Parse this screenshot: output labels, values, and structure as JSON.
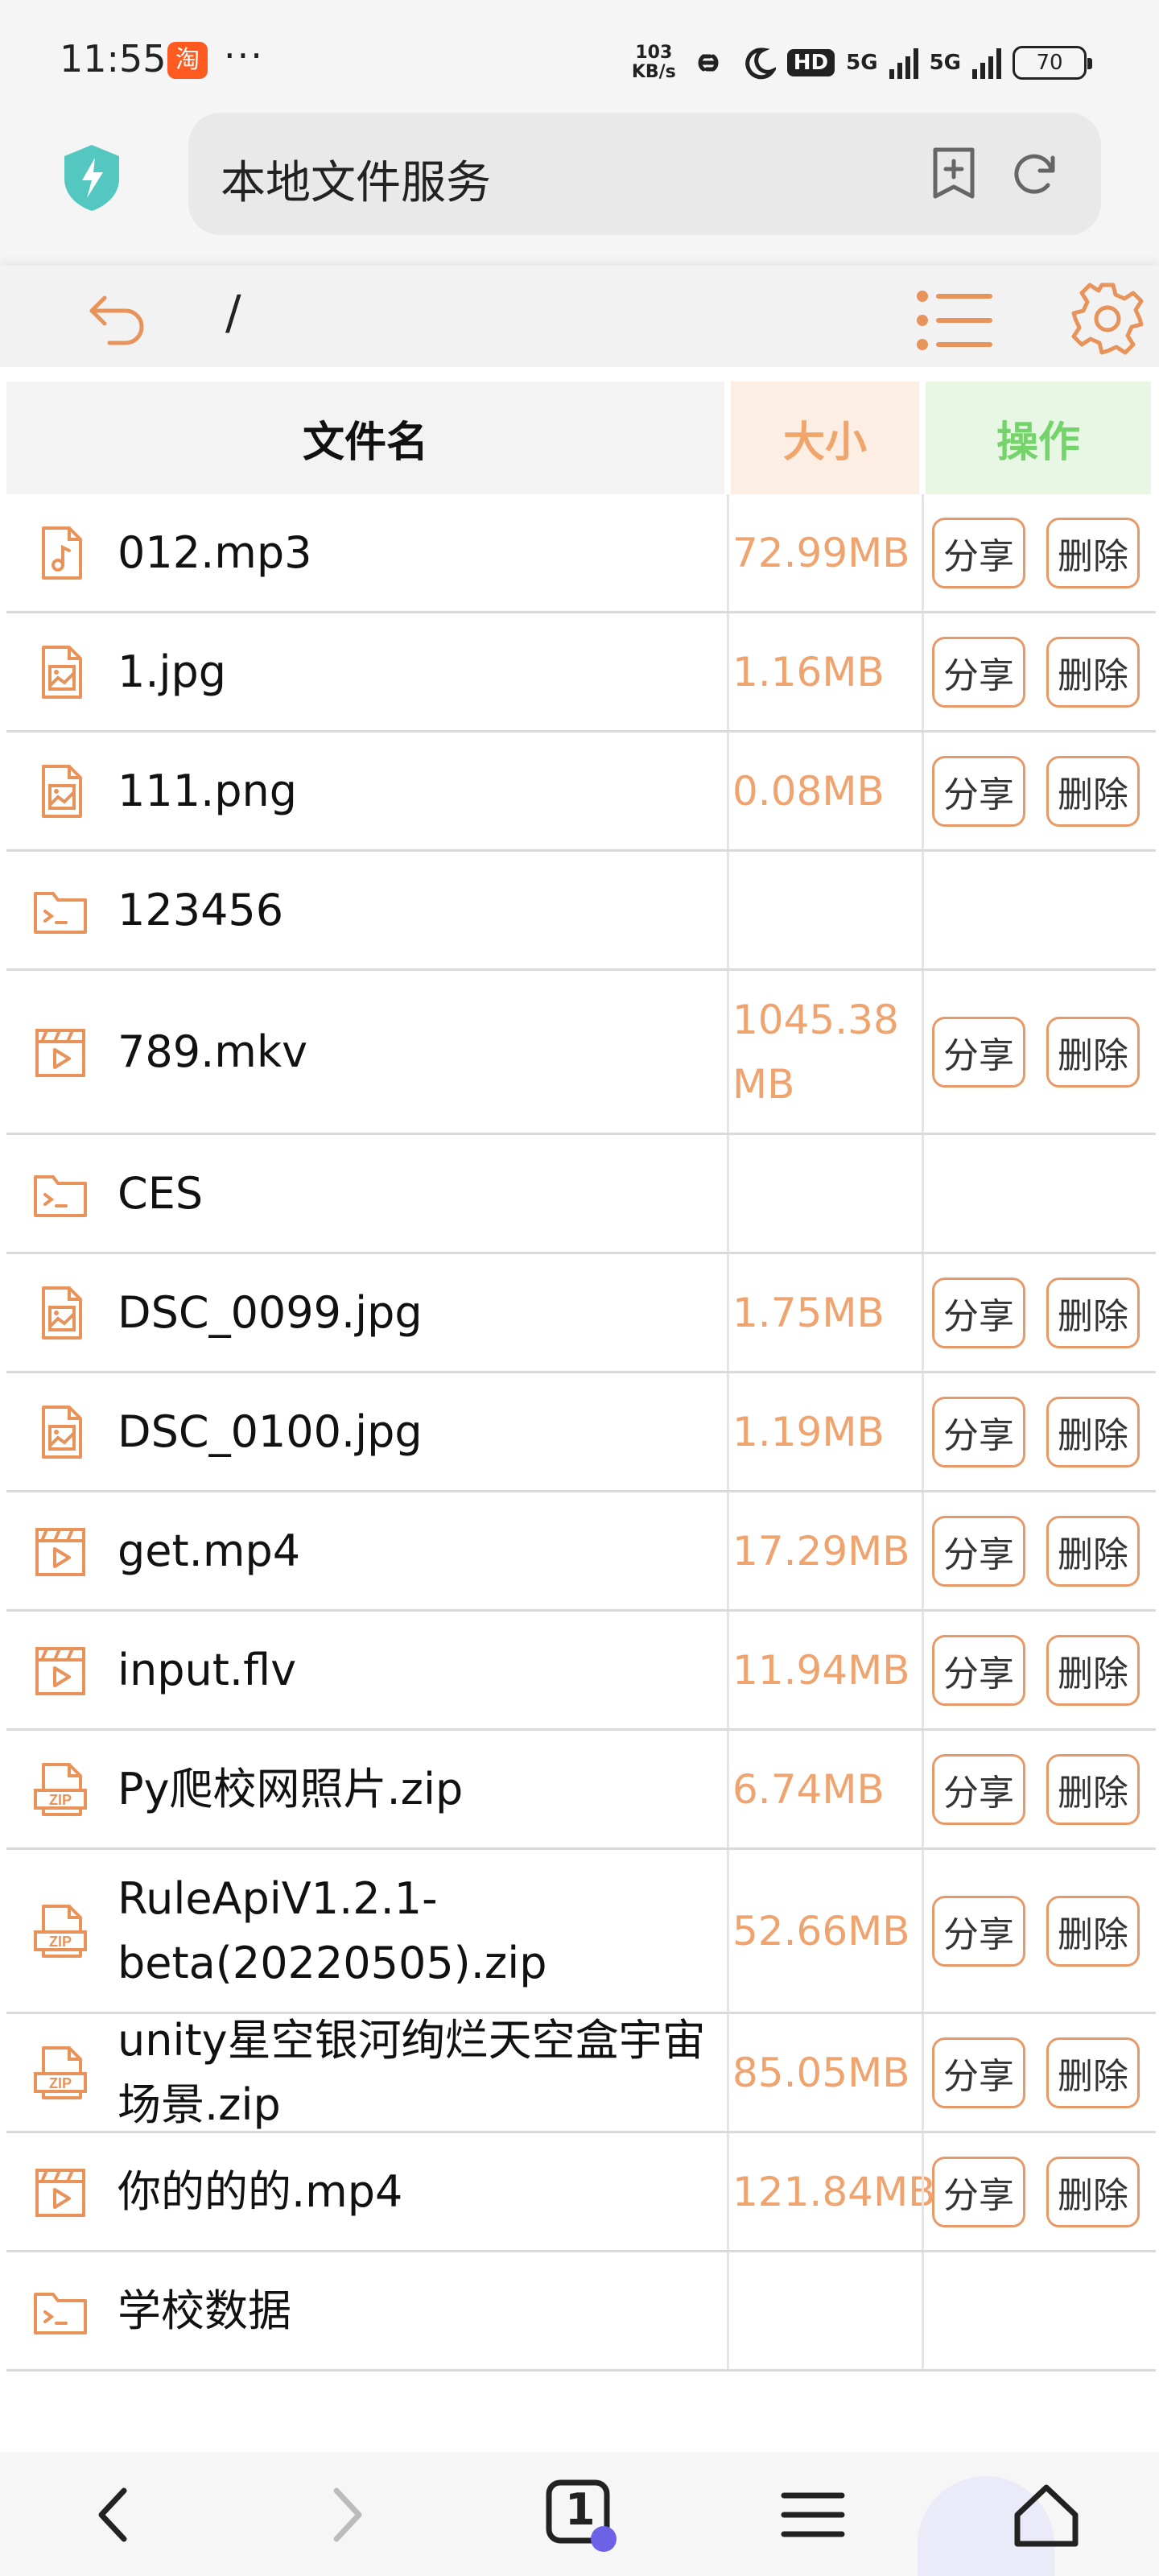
{
  "status": {
    "time": "11:55",
    "taobao": "淘",
    "dots": "···",
    "speed_value": "103",
    "speed_unit": "KB/s",
    "hd": "HD",
    "net1": "5G",
    "net2": "5G",
    "battery": "70"
  },
  "browser": {
    "title": "本地文件服务"
  },
  "toolbar": {
    "path": "/"
  },
  "table": {
    "headers": {
      "name": "文件名",
      "size": "大小",
      "ops": "操作"
    },
    "share_label": "分享",
    "delete_label": "删除",
    "rows": [
      {
        "type": "audio",
        "name": "012.mp3",
        "size": "72.99MB"
      },
      {
        "type": "image",
        "name": "1.jpg",
        "size": "1.16MB"
      },
      {
        "type": "image",
        "name": "111.png",
        "size": "0.08MB"
      },
      {
        "type": "folder",
        "name": "123456",
        "size": ""
      },
      {
        "type": "video",
        "name": "789.mkv",
        "size": "1045.38 MB"
      },
      {
        "type": "folder",
        "name": "CES",
        "size": ""
      },
      {
        "type": "image",
        "name": "DSC_0099.jpg",
        "size": "1.75MB"
      },
      {
        "type": "image",
        "name": "DSC_0100.jpg",
        "size": "1.19MB"
      },
      {
        "type": "video",
        "name": "get.mp4",
        "size": "17.29MB"
      },
      {
        "type": "video",
        "name": "input.flv",
        "size": "11.94MB"
      },
      {
        "type": "zip",
        "name": "Py爬校网照片.zip",
        "size": "6.74MB"
      },
      {
        "type": "zip",
        "name": "RuleApiV1.2.1-beta(20220505).zip",
        "size": "52.66MB"
      },
      {
        "type": "zip",
        "name": "unity星空银河绚烂天空盒宇宙场景.zip",
        "size": "85.05MB"
      },
      {
        "type": "video",
        "name": "你的的的.mp4",
        "size": "121.84MB"
      },
      {
        "type": "folder",
        "name": "学校数据",
        "size": ""
      }
    ]
  },
  "nav": {
    "tab_count": "1"
  },
  "colors": {
    "accent": "#e8935a",
    "size_text": "#efa470",
    "ops_header": "#74d36b"
  }
}
